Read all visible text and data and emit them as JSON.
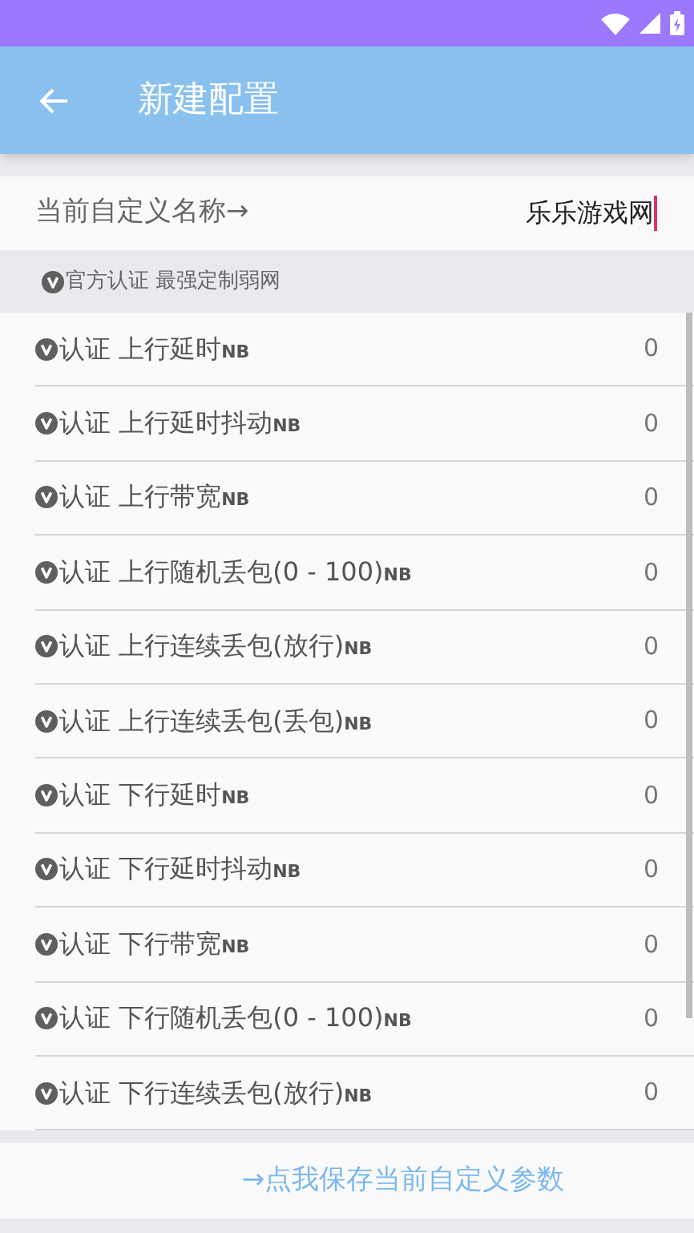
{
  "app_bar": {
    "title": "新建配置"
  },
  "name_field": {
    "label": "当前自定义名称→",
    "value": "乐乐游戏网"
  },
  "section_header": "官方认证 最强定制弱网",
  "params": [
    {
      "label": "认证 上行延时",
      "unit": "NB",
      "value": "0"
    },
    {
      "label": "认证 上行延时抖动",
      "unit": "NB",
      "value": "0"
    },
    {
      "label": "认证 上行带宽",
      "unit": "NB",
      "value": "0"
    },
    {
      "label": "认证 上行随机丢包(0 - 100)",
      "unit": "NB",
      "value": "0"
    },
    {
      "label": "认证 上行连续丢包(放行)",
      "unit": "NB",
      "value": "0"
    },
    {
      "label": "认证 上行连续丢包(丢包)",
      "unit": "NB",
      "value": "0"
    },
    {
      "label": "认证 下行延时",
      "unit": "NB",
      "value": "0"
    },
    {
      "label": "认证 下行延时抖动",
      "unit": "NB",
      "value": "0"
    },
    {
      "label": "认证 下行带宽",
      "unit": "NB",
      "value": "0"
    },
    {
      "label": "认证 下行随机丢包(0 - 100)",
      "unit": "NB",
      "value": "0"
    },
    {
      "label": "认证 下行连续丢包(放行)",
      "unit": "NB",
      "value": "0"
    }
  ],
  "save_link": "→点我保存当前自定义参数"
}
